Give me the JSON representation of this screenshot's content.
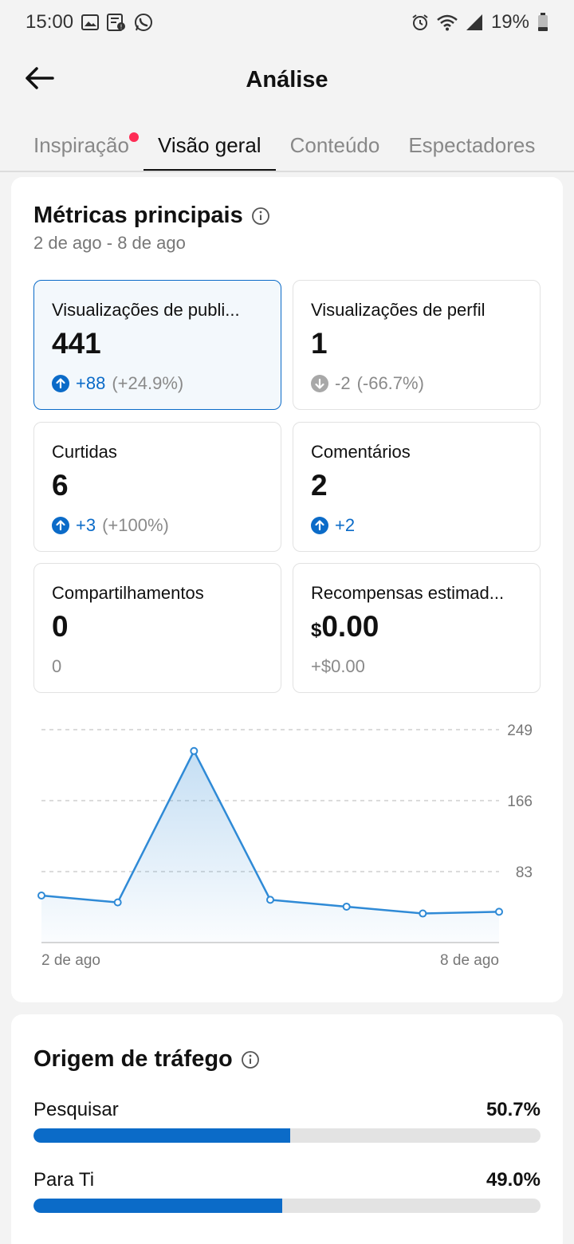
{
  "status_bar": {
    "time": "15:00",
    "battery": "19%",
    "left_icons": [
      "image-icon",
      "news-icon",
      "whatsapp-icon"
    ],
    "right_icons": [
      "alarm-icon",
      "wifi-icon",
      "signal-icon",
      "battery-icon"
    ]
  },
  "header": {
    "title": "Análise",
    "back_icon": "back-arrow-icon"
  },
  "tabs": [
    {
      "label": "Inspiração",
      "has_dot": true,
      "active": false
    },
    {
      "label": "Visão geral",
      "has_dot": false,
      "active": true
    },
    {
      "label": "Conteúdo",
      "has_dot": false,
      "active": false
    },
    {
      "label": "Espectadores",
      "has_dot": false,
      "active": false
    }
  ],
  "key_metrics": {
    "title": "Métricas principais",
    "date_range": "2 de ago - 8 de ago",
    "cards": [
      {
        "label": "Visualizações de publi...",
        "value": "441",
        "change": "+88",
        "change_pct": "(+24.9%)",
        "direction": "up",
        "selected": true
      },
      {
        "label": "Visualizações de perfil",
        "value": "1",
        "change": "-2",
        "change_pct": "(-66.7%)",
        "direction": "down",
        "selected": false
      },
      {
        "label": "Curtidas",
        "value": "6",
        "change": "+3",
        "change_pct": "(+100%)",
        "direction": "up",
        "selected": false
      },
      {
        "label": "Comentários",
        "value": "2",
        "change": "+2",
        "change_pct": "",
        "direction": "up",
        "selected": false
      },
      {
        "label": "Compartilhamentos",
        "value": "0",
        "change": "0",
        "change_pct": "",
        "direction": "none",
        "selected": false
      },
      {
        "label": "Recompensas estimad...",
        "value_currency": "$",
        "value": "0.00",
        "change": "+$0.00",
        "change_pct": "",
        "direction": "none",
        "selected": false
      }
    ]
  },
  "chart_data": {
    "type": "area",
    "x": [
      "2 de ago",
      "3 de ago",
      "4 de ago",
      "5 de ago",
      "6 de ago",
      "7 de ago",
      "8 de ago"
    ],
    "x_tick_labels": [
      "2 de ago",
      "8 de ago"
    ],
    "values": [
      55,
      47,
      224,
      50,
      42,
      34,
      36
    ],
    "y_ticks": [
      "83",
      "166",
      "249"
    ],
    "ylim": [
      0,
      249
    ],
    "grid": "horizontal dashed",
    "color": "#2f8ad6"
  },
  "traffic": {
    "title": "Origem de tráfego",
    "rows": [
      {
        "label": "Pesquisar",
        "pct": "50.7%",
        "value": 50.7
      },
      {
        "label": "Para Ti",
        "pct": "49.0%",
        "value": 49.0
      }
    ]
  },
  "colors": {
    "accent": "#0b6bc8",
    "notification_dot": "#fe2c55",
    "background": "#f3f3f3"
  }
}
